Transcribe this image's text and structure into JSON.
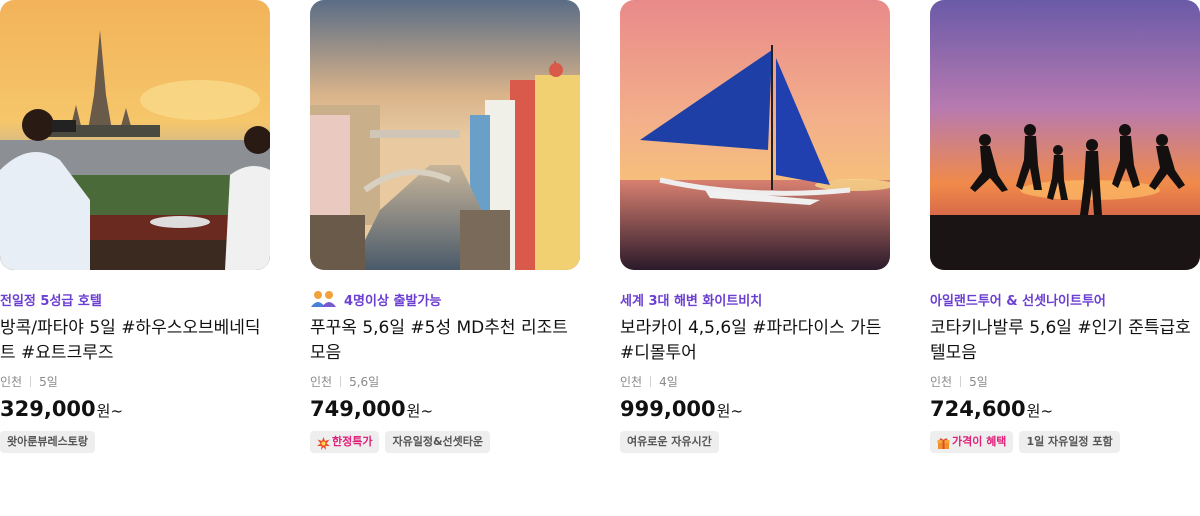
{
  "products": [
    {
      "image_icon": "wat-arun-sunset-photo",
      "highlight": "전일정 5성급 호텔",
      "title": "방콕/파타야 5일 #하우스오브베네딕트 #요트크루즈",
      "departure": "인천",
      "duration": "5일",
      "price": "329,000",
      "price_unit": "원~",
      "tags": [
        {
          "label": "왓아룬뷰레스토랑",
          "style": "default"
        }
      ]
    },
    {
      "image_icon": "venice-canal-town-photo",
      "highlight_icon": "people-group-icon",
      "highlight": "4명이상 출발가능",
      "title": "푸꾸옥 5,6일 #5성 MD추천 리조트모음",
      "departure": "인천",
      "duration": "5,6일",
      "price": "749,000",
      "price_unit": "원~",
      "tags": [
        {
          "label": "한정특가",
          "style": "accent",
          "icon": "burst-icon"
        },
        {
          "label": "자유일정&선셋타운",
          "style": "default"
        }
      ]
    },
    {
      "image_icon": "sailboat-sunset-photo",
      "highlight": "세계 3대 해변 화이트비치",
      "title": "보라카이 4,5,6일 #파라다이스 가든 #디몰투어",
      "departure": "인천",
      "duration": "4일",
      "price": "999,000",
      "price_unit": "원~",
      "tags": [
        {
          "label": "여유로운 자유시간",
          "style": "default"
        }
      ]
    },
    {
      "image_icon": "jumping-silhouettes-photo",
      "highlight": "아일랜드투어 & 선셋나이트투어",
      "title": "코타키나발루 5,6일 #인기 준특급호텔모음",
      "departure": "인천",
      "duration": "5일",
      "price": "724,600",
      "price_unit": "원~",
      "tags": [
        {
          "label": "가격이 혜택",
          "style": "accent",
          "icon": "gift-icon"
        },
        {
          "label": "1일 자유일정 포함",
          "style": "default"
        }
      ]
    }
  ],
  "colors": {
    "highlight": "#6b3fd1",
    "accent_tag": "#e0207a",
    "tag_bg": "#eeeeee",
    "meta": "#8a8a8a"
  }
}
